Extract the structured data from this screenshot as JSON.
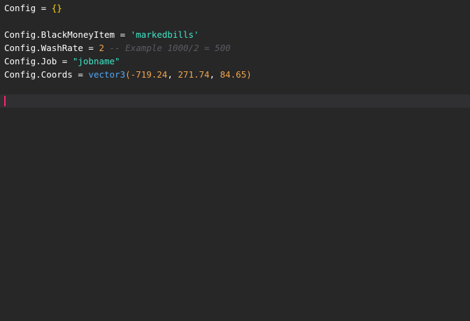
{
  "editor": {
    "lines": [
      {
        "tokens": [
          {
            "text": "Config",
            "kind": "plain"
          },
          {
            "text": " = ",
            "kind": "plain"
          },
          {
            "text": "{}",
            "kind": "brace"
          }
        ]
      },
      {
        "tokens": []
      },
      {
        "tokens": [
          {
            "text": "Config.BlackMoneyItem",
            "kind": "plain"
          },
          {
            "text": " = ",
            "kind": "plain"
          },
          {
            "text": "'markedbills'",
            "kind": "string"
          }
        ]
      },
      {
        "tokens": [
          {
            "text": "Config.WashRate",
            "kind": "plain"
          },
          {
            "text": " = ",
            "kind": "plain"
          },
          {
            "text": "2",
            "kind": "number"
          },
          {
            "text": " ",
            "kind": "plain"
          },
          {
            "text": "-- Example 1000/2 = 500",
            "kind": "comment"
          }
        ]
      },
      {
        "tokens": [
          {
            "text": "Config.Job",
            "kind": "plain"
          },
          {
            "text": " = ",
            "kind": "plain"
          },
          {
            "text": "\"jobname\"",
            "kind": "string"
          }
        ]
      },
      {
        "tokens": [
          {
            "text": "Config.Coords",
            "kind": "plain"
          },
          {
            "text": " = ",
            "kind": "plain"
          },
          {
            "text": "vector3",
            "kind": "function"
          },
          {
            "text": "(",
            "kind": "num-paren"
          },
          {
            "text": "-719.24",
            "kind": "number"
          },
          {
            "text": ", ",
            "kind": "plain"
          },
          {
            "text": "271.74",
            "kind": "number"
          },
          {
            "text": ", ",
            "kind": "plain"
          },
          {
            "text": "84.65",
            "kind": "number"
          },
          {
            "text": ")",
            "kind": "num-paren"
          }
        ]
      },
      {
        "tokens": []
      },
      {
        "tokens": [],
        "current": true
      }
    ],
    "colors": {
      "background": "#272728",
      "current_line": "#303032",
      "cursor": "#f9266d",
      "brace": "#f5d50a",
      "string": "#3ee6c6",
      "number": "#f2a54a",
      "comment": "#5b5b63",
      "function": "#52a7f2"
    }
  }
}
